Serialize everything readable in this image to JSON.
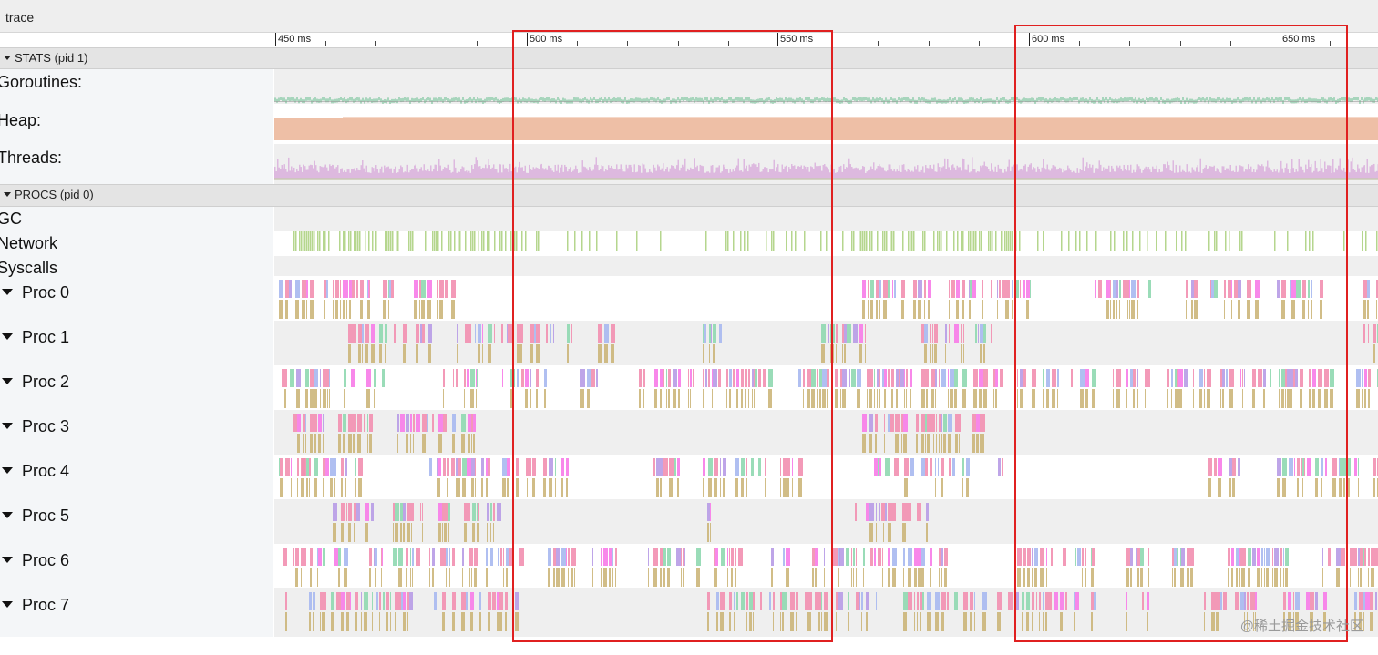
{
  "title": "trace",
  "ruler": {
    "labels": [
      {
        "text": "450 ms",
        "ms": 450
      },
      {
        "text": "500 ms",
        "ms": 500
      },
      {
        "text": "550 ms",
        "ms": 550
      },
      {
        "text": "600 ms",
        "ms": 600
      },
      {
        "text": "650 ms",
        "ms": 650
      }
    ]
  },
  "sections": {
    "stats": "STATS (pid 1)",
    "procs": "PROCS (pid 0)"
  },
  "stats_rows": [
    "Goroutines:",
    "Heap:",
    "Threads:"
  ],
  "misc_rows": [
    "GC",
    "Network",
    "Syscalls"
  ],
  "procs": [
    "Proc 0",
    "Proc 1",
    "Proc 2",
    "Proc 3",
    "Proc 4",
    "Proc 5",
    "Proc 6",
    "Proc 7"
  ],
  "watermark": "@稀土掘金技术社区",
  "colors": {
    "highlight": "#e02020",
    "heap": "#eebfa6",
    "threads": "#d7a7d9",
    "goroutines": "#9fd1b6",
    "network": "#a8cf7a",
    "event_pink": "#f28fb0",
    "event_violet": "#b79be6",
    "event_magenta": "#f77be8",
    "event_blue": "#a7b8f0",
    "event_green": "#8fd8b0",
    "syscall_tan": "#c9b272"
  }
}
